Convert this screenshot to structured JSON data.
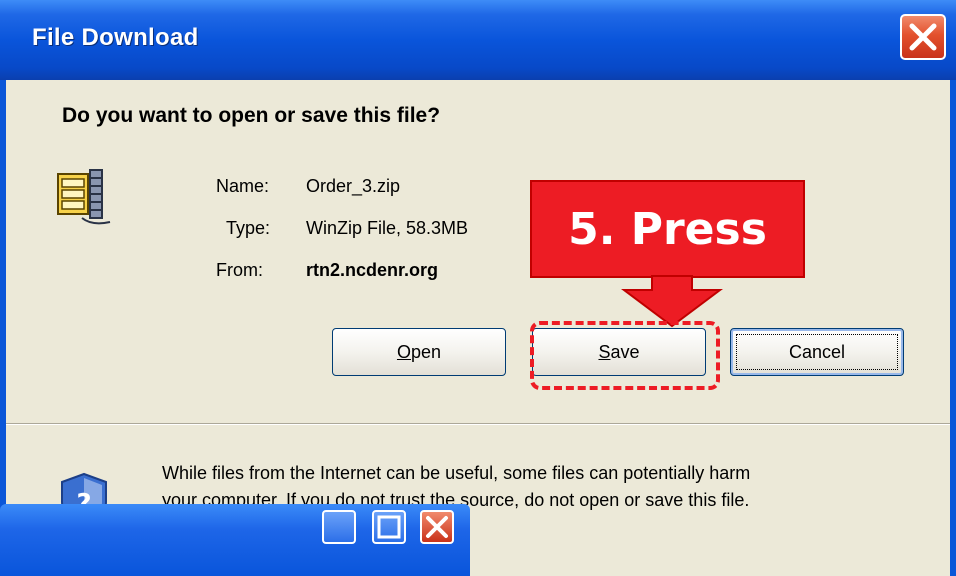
{
  "dialog": {
    "title": "File Download",
    "question": "Do you want to open or save this file?",
    "file": {
      "name_label": "Name:",
      "name_value": "Order_3.zip",
      "type_label": "Type:",
      "type_value": "WinZip File, 58.3MB",
      "from_label": "From:",
      "from_value": "rtn2.ncdenr.org"
    },
    "buttons": {
      "open_accel": "O",
      "open_rest": "pen",
      "save_accel": "S",
      "save_rest": "ave",
      "cancel": "Cancel"
    },
    "warning_line1": "While files from the Internet can be useful, some files can potentially harm",
    "warning_line2": "your computer. If you do not trust the source, do not open or save this file."
  },
  "annotation": {
    "label": "5.  Press",
    "color": "#ed1c24"
  },
  "icons": {
    "close": "close-icon",
    "file": "zip-file-icon",
    "shield": "shield-question-icon"
  }
}
